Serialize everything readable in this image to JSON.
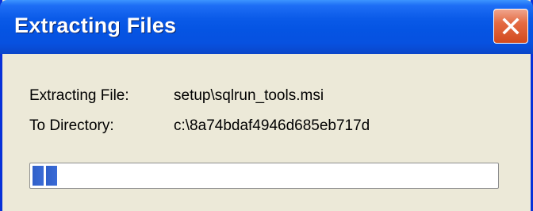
{
  "window": {
    "title": "Extracting Files",
    "close_label": "Close"
  },
  "details": {
    "file_label": "Extracting File:",
    "file_value": "setup\\sqlrun_tools.msi",
    "directory_label": "To Directory:",
    "directory_value": "c:\\8a74bdaf4946d685eb717d"
  },
  "progress": {
    "fraction": 0.057
  },
  "colors": {
    "title_bar": "#0554E3",
    "progress_block": "#2F5FC9",
    "dialog_background": "#ECE9D8"
  },
  "icons": {
    "close": "close-icon"
  }
}
